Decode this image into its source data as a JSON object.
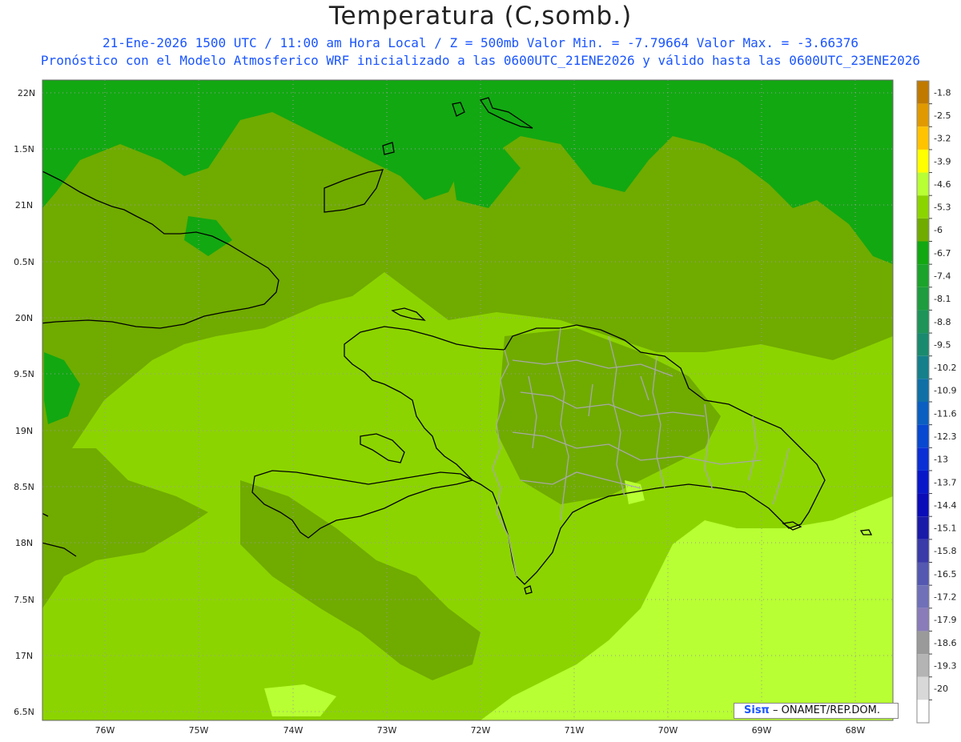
{
  "header": {
    "title": "Temperatura (C,somb.)",
    "subtitle_line1": "21-Ene-2026  1500 UTC / 11:00 am Hora Local / Z = 500mb  Valor Min. = -7.79664  Valor Max. = -3.66376",
    "subtitle_line2": "Pronóstico con el Modelo Atmosferico WRF inicializado a las 0600UTC_21ENE2026 y válido hasta las  0600UTC_23ENE2026"
  },
  "map": {
    "lat_labels": [
      "22N",
      "1.5N",
      "21N",
      "0.5N",
      "20N",
      "9.5N",
      "19N",
      "8.5N",
      "18N",
      "7.5N",
      "17N",
      "6.5N"
    ],
    "lon_labels": [
      "76W",
      "75W",
      "74W",
      "73W",
      "72W",
      "71W",
      "70W",
      "69W",
      "68W"
    ]
  },
  "colorbar": {
    "labels": [
      "-1.8",
      "-2.5",
      "-3.2",
      "-3.9",
      "-4.6",
      "-5.3",
      "-6",
      "-6.7",
      "-7.4",
      "-8.1",
      "-8.8",
      "-9.5",
      "-10.2",
      "-10.9",
      "-11.6",
      "-12.3",
      "-13",
      "-13.7",
      "-14.4",
      "-15.1",
      "-15.8",
      "-16.5",
      "-17.2",
      "-17.9",
      "-18.6",
      "-19.3",
      "-20"
    ],
    "colors": [
      "#c07a00",
      "#e09a00",
      "#ffc300",
      "#ffff00",
      "#b8ff33",
      "#8cd400",
      "#70ab00",
      "#12a812",
      "#1ba32b",
      "#1e9c3e",
      "#1e9458",
      "#1a8a6e",
      "#15808a",
      "#1070a6",
      "#0b5fc0",
      "#0848d0",
      "#0a2fd4",
      "#0818c8",
      "#0a0cb8",
      "#1a1aa8",
      "#3a3aa8",
      "#5558b0",
      "#7070b8",
      "#8a7cb8",
      "#9a9a9a",
      "#b4b4b4",
      "#d8d8d8",
      "#ffffff"
    ]
  },
  "credit": {
    "logo": "Sisπ",
    "text": " – ONAMET/REP.DOM."
  }
}
